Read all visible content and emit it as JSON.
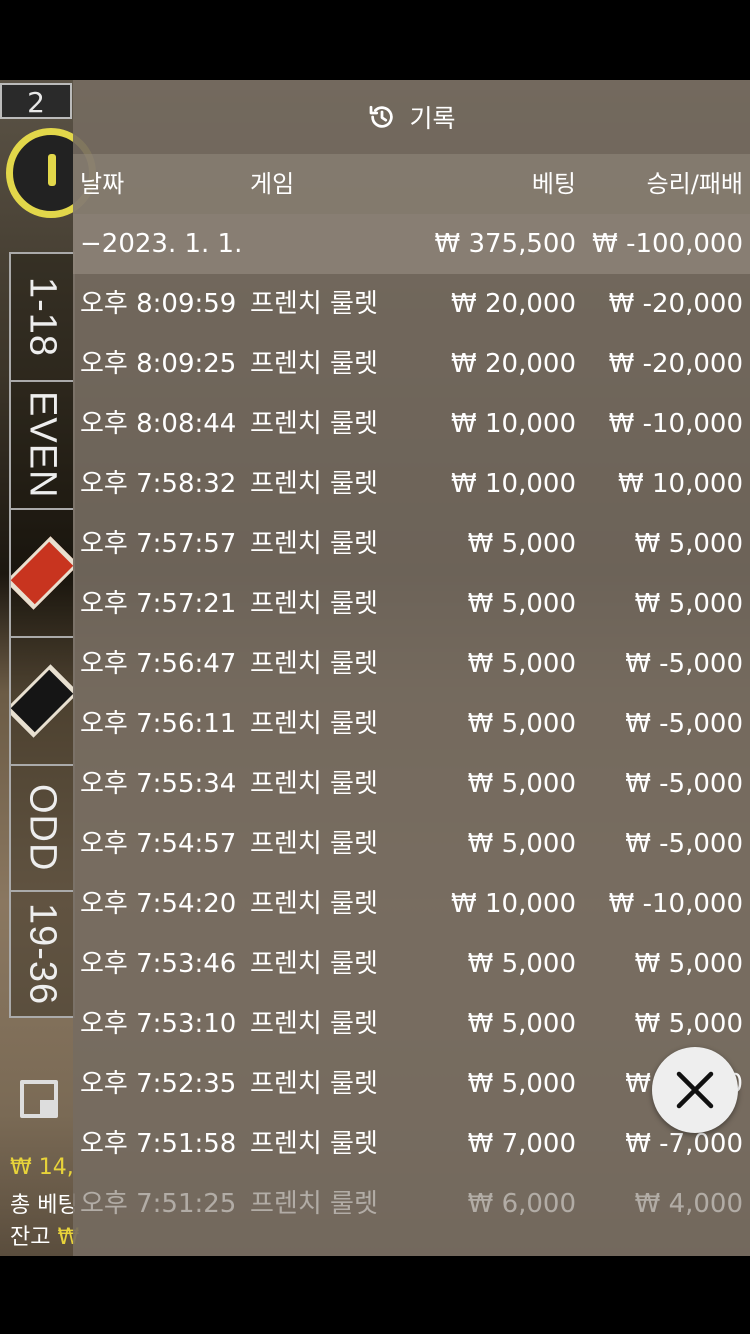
{
  "game_strip": {
    "round_number": "2",
    "bets": [
      "1-18",
      "EVEN",
      "RED",
      "BLACK",
      "ODD",
      "19-36"
    ],
    "colors": {
      "red": "#c8341f",
      "black": "#151515",
      "timer": "#e2d74a"
    }
  },
  "left_info": {
    "win_amount": "₩ 14,",
    "total_bet_label": "총 베팅",
    "balance_label": "잔고",
    "balance_prefix": "₩"
  },
  "panel": {
    "title": "기록",
    "icon": "history-icon",
    "columns": {
      "date": "날짜",
      "game": "게임",
      "bet": "베팅",
      "win_loss": "승리/패배"
    },
    "summary": {
      "date": "−2023. 1. 1.",
      "bet": "₩ 375,500",
      "win_loss": "₩ -100,000"
    },
    "rows": [
      {
        "time": "오후 8:09:59",
        "game": "프렌치 룰렛",
        "bet": "₩ 20,000",
        "result": "₩ -20,000"
      },
      {
        "time": "오후 8:09:25",
        "game": "프렌치 룰렛",
        "bet": "₩ 20,000",
        "result": "₩ -20,000"
      },
      {
        "time": "오후 8:08:44",
        "game": "프렌치 룰렛",
        "bet": "₩ 10,000",
        "result": "₩ -10,000"
      },
      {
        "time": "오후 7:58:32",
        "game": "프렌치 룰렛",
        "bet": "₩ 10,000",
        "result": "₩ 10,000"
      },
      {
        "time": "오후 7:57:57",
        "game": "프렌치 룰렛",
        "bet": "₩ 5,000",
        "result": "₩ 5,000"
      },
      {
        "time": "오후 7:57:21",
        "game": "프렌치 룰렛",
        "bet": "₩ 5,000",
        "result": "₩ 5,000"
      },
      {
        "time": "오후 7:56:47",
        "game": "프렌치 룰렛",
        "bet": "₩ 5,000",
        "result": "₩ -5,000"
      },
      {
        "time": "오후 7:56:11",
        "game": "프렌치 룰렛",
        "bet": "₩ 5,000",
        "result": "₩ -5,000"
      },
      {
        "time": "오후 7:55:34",
        "game": "프렌치 룰렛",
        "bet": "₩ 5,000",
        "result": "₩ -5,000"
      },
      {
        "time": "오후 7:54:57",
        "game": "프렌치 룰렛",
        "bet": "₩ 5,000",
        "result": "₩ -5,000"
      },
      {
        "time": "오후 7:54:20",
        "game": "프렌치 룰렛",
        "bet": "₩ 10,000",
        "result": "₩ -10,000"
      },
      {
        "time": "오후 7:53:46",
        "game": "프렌치 룰렛",
        "bet": "₩ 5,000",
        "result": "₩ 5,000"
      },
      {
        "time": "오후 7:53:10",
        "game": "프렌치 룰렛",
        "bet": "₩ 5,000",
        "result": "₩ 5,000"
      },
      {
        "time": "오후 7:52:35",
        "game": "프렌치 룰렛",
        "bet": "₩ 5,000",
        "result": "₩ -5,000"
      },
      {
        "time": "오후 7:51:58",
        "game": "프렌치 룰렛",
        "bet": "₩ 7,000",
        "result": "₩ -7,000"
      },
      {
        "time": "오후 7:51:25",
        "game": "프렌치 룰렛",
        "bet": "₩ 6,000",
        "result": "₩ 4,000"
      }
    ],
    "close_icon": "close-icon"
  }
}
